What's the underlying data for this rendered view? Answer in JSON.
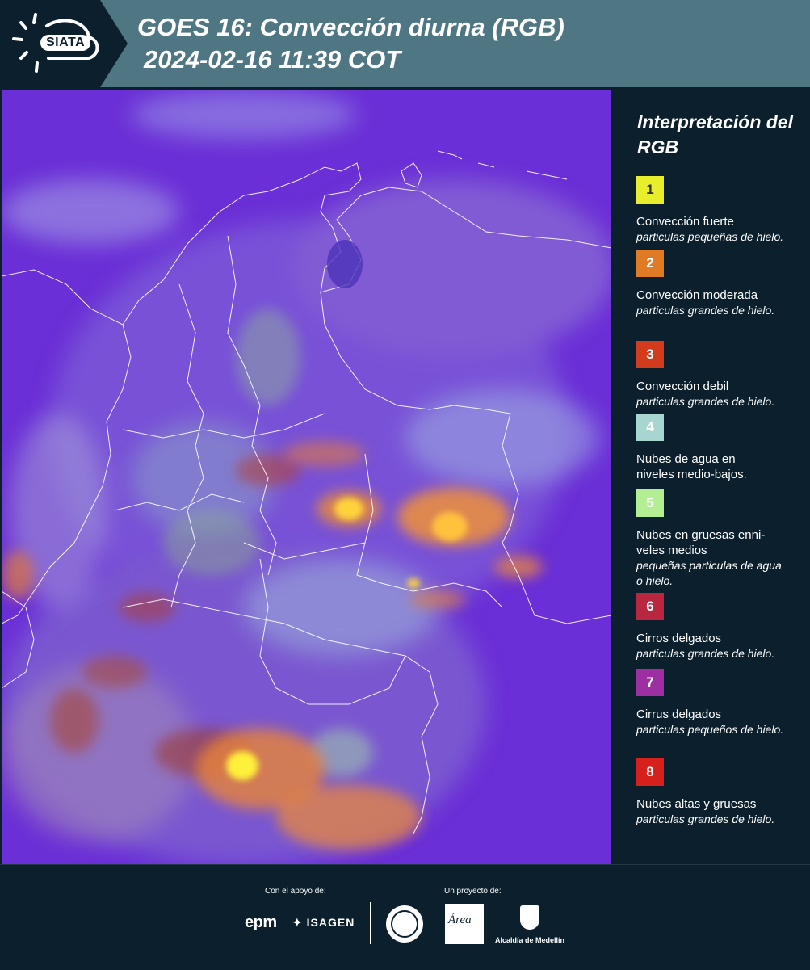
{
  "header": {
    "logo_text": "SIATA",
    "title_line1": "GOES 16: Convección diurna (RGB)",
    "title_line2": "2024-02-16 11:39 COT",
    "logo_icon": "sun-cloud-icon",
    "color": "#4f7683"
  },
  "map": {
    "base_color": "#6a2fd6",
    "boundary_color": "#ffffff"
  },
  "legend": {
    "title": "Interpretación del RGB",
    "items": [
      {
        "number": "1",
        "color": "#e8ee2c",
        "text_color": "#2a2a10",
        "title": "Convección fuerte",
        "subtitle": "particulas pequeñas de hielo."
      },
      {
        "number": "2",
        "color": "#e07a25",
        "text_color": "#ffffff",
        "title": "Convección moderada",
        "subtitle": "particulas grandes de hielo."
      },
      {
        "number": "3",
        "color": "#d23b1c",
        "text_color": "#ffffff",
        "title": "Convección debil",
        "subtitle": "particulas grandes de hielo."
      },
      {
        "number": "4",
        "color": "#a6d6cf",
        "text_color": "#ffffff",
        "title": "Nubes de agua en niveles medio-bajos.",
        "subtitle": ""
      },
      {
        "number": "5",
        "color": "#b4ee92",
        "text_color": "#ffffff",
        "title": "Nubes en gruesas enni-veles medios",
        "subtitle": "pequeñas particulas de agua o hielo."
      },
      {
        "number": "6",
        "color": "#b8263f",
        "text_color": "#ffffff",
        "title": "Cirros delgados",
        "subtitle": "particulas grandes de hielo."
      },
      {
        "number": "7",
        "color": "#9e2fa2",
        "text_color": "#ffffff",
        "title": "Cirrus delgados",
        "subtitle": "particulas pequeños de hielo."
      },
      {
        "number": "8",
        "color": "#d5201b",
        "text_color": "#ffffff",
        "title": "Nubes altas y gruesas",
        "subtitle": "particulas grandes de hielo."
      }
    ]
  },
  "footer": {
    "support_label": "Con el apoyo de:",
    "project_label": "Un proyecto de:",
    "epm": "epm",
    "isagen": "ISAGEN",
    "area_logo_text": "Área",
    "alcaldia": "Alcaldía de Medellín"
  }
}
